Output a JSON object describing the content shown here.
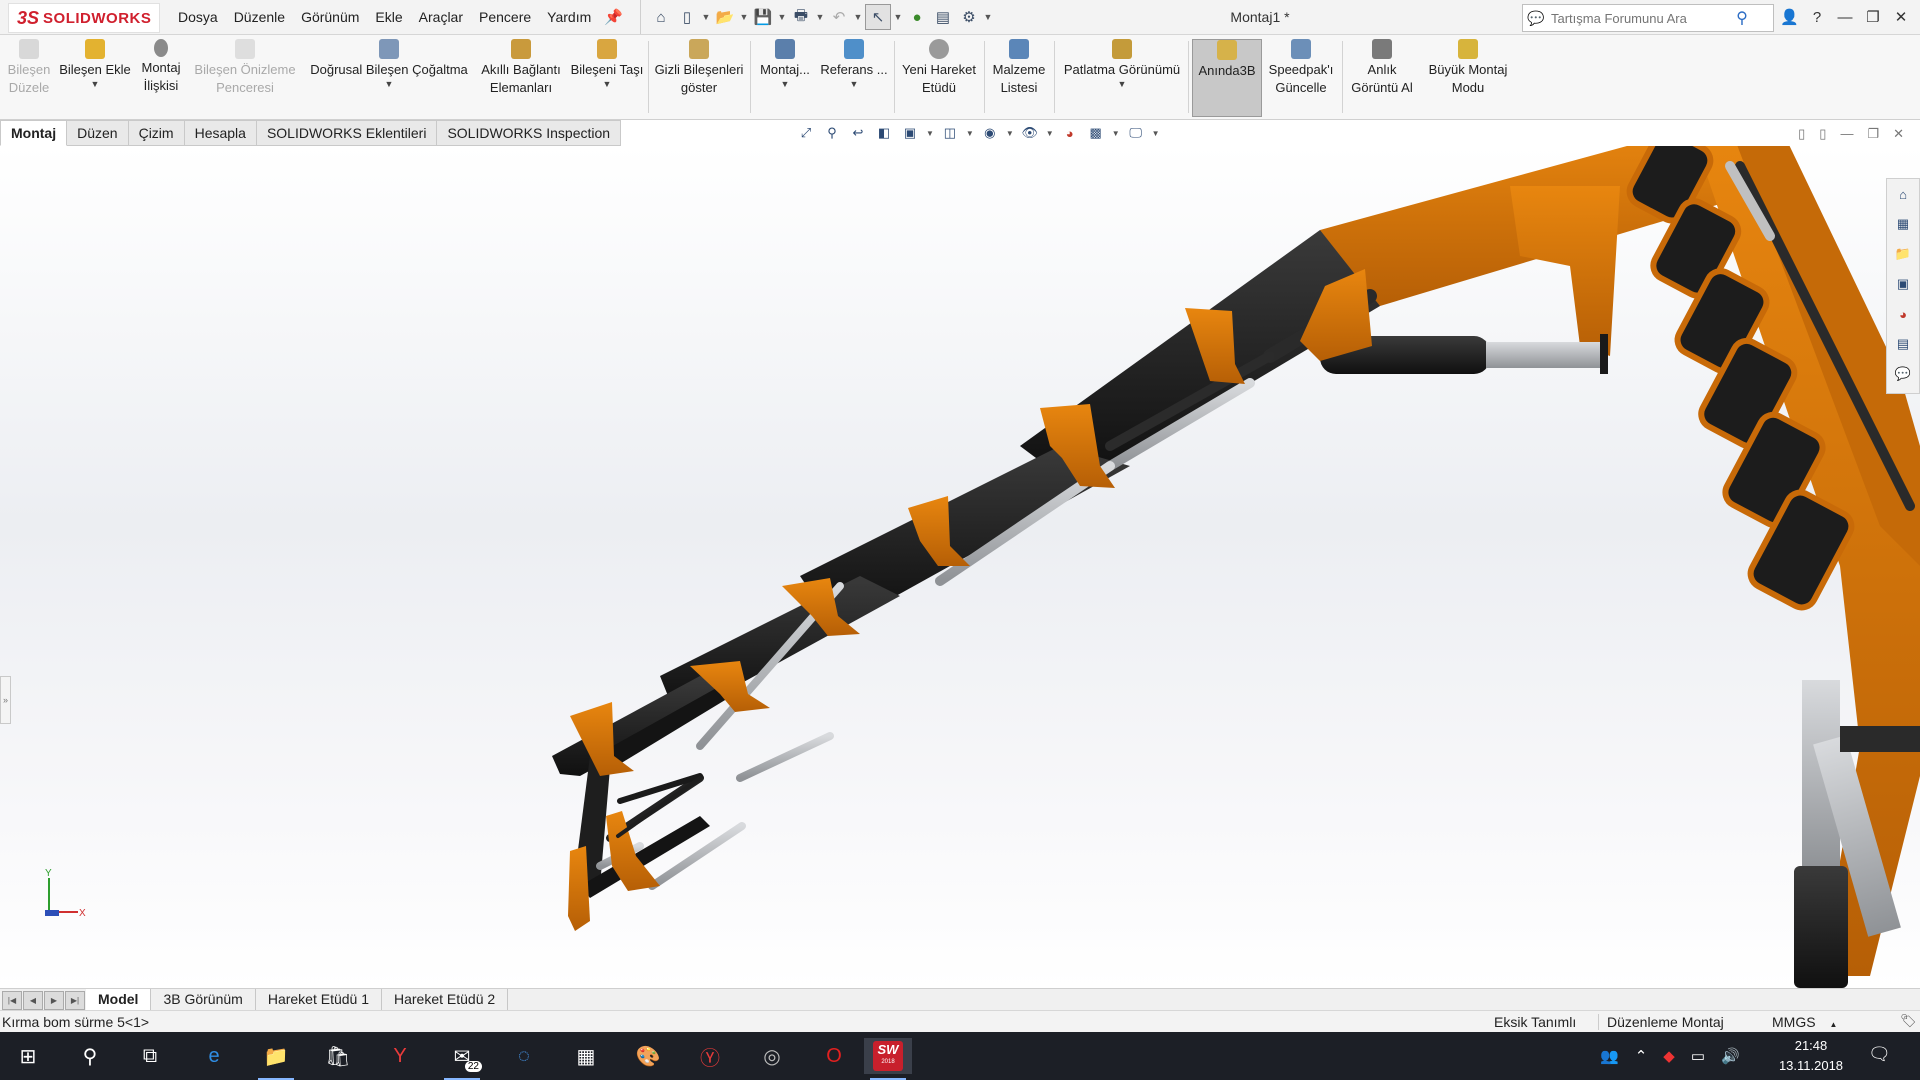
{
  "app": {
    "logo_ds": "3S",
    "logo_text": "SOLIDWORKS",
    "document_title": "Montaj1 *"
  },
  "menu": [
    "Dosya",
    "Düzenle",
    "Görünüm",
    "Ekle",
    "Araçlar",
    "Pencere",
    "Yardım"
  ],
  "search": {
    "placeholder": "Tartışma Forumunu Ara"
  },
  "command_bar": {
    "edit_component": "Bileşen Düzele",
    "insert_component": "Bileşen Ekle",
    "mate": "Montaj İlişkisi",
    "component_preview": "Bileşen Önizleme Penceresi",
    "linear_pattern": "Doğrusal Bileşen Çoğaltma",
    "smart_fasteners": "Akıllı Bağlantı Elemanları",
    "move_component": "Bileşeni Taşı",
    "show_hidden": "Gizli Bileşenleri göster",
    "assembly_features": "Montaj...",
    "reference_geometry": "Referans ...",
    "new_motion_study": "Yeni Hareket Etüdü",
    "bom": "Malzeme Listesi",
    "exploded_view": "Patlatma Görünümü",
    "instant3d": "Anında3B",
    "update_speedpak": "Speedpak'ı Güncelle",
    "snapshot": "Anlık Görüntü Al",
    "large_assembly": "Büyük Montaj Modu"
  },
  "tabs": [
    "Montaj",
    "Düzen",
    "Çizim",
    "Hesapla",
    "SOLIDWORKS Eklentileri",
    "SOLIDWORKS Inspection"
  ],
  "triad": {
    "x": "X",
    "y": "Y"
  },
  "bottom_tabs": [
    "Model",
    "3B Görünüm",
    "Hareket Etüdü 1",
    "Hareket Etüdü 2"
  ],
  "status": {
    "selection": "Kırma bom sürme 5<1>",
    "definition": "Eksik Tanımlı",
    "mode": "Düzenleme Montaj",
    "units": "MMGS",
    "units_caret": "▲"
  },
  "taskbar": {
    "mail_badge": "22",
    "sw_label": "SW",
    "sw_year": "2018",
    "time": "21:48",
    "date": "13.11.2018"
  },
  "colors": {
    "boom_orange": "#d9770d",
    "boom_black": "#1f1f1f",
    "piston_gray": "#b9bcc0",
    "brand_red": "#d0202e"
  }
}
